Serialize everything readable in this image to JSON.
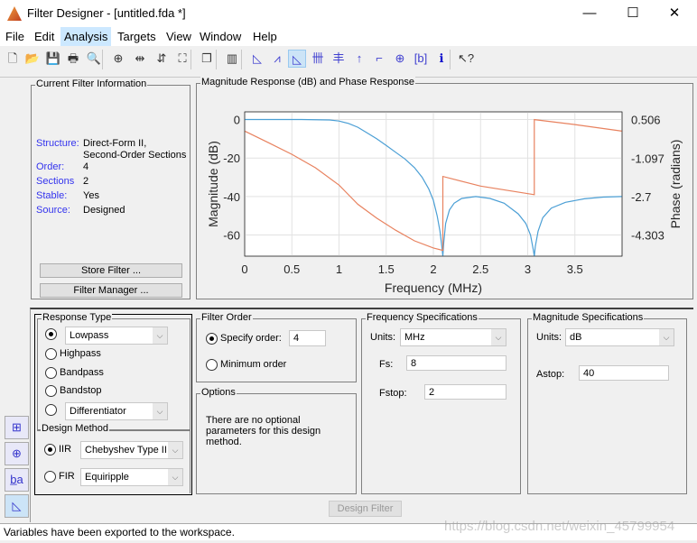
{
  "window": {
    "title": "Filter Designer -  [untitled.fda *]",
    "minimize": "—",
    "maximize": "☐",
    "close": "✕"
  },
  "menu": [
    "File",
    "Edit",
    "Analysis",
    "Targets",
    "View",
    "Window",
    "Help"
  ],
  "toolbar": [
    {
      "icon": "new-icon",
      "glyph": "🗋"
    },
    {
      "icon": "open-icon",
      "glyph": "📂"
    },
    {
      "icon": "save-icon",
      "glyph": "💾"
    },
    {
      "icon": "print-icon",
      "glyph": "🖶"
    },
    {
      "icon": "print-preview-icon",
      "glyph": "🔍"
    },
    {
      "icon": "zoom-in-icon",
      "glyph": "⊕"
    },
    {
      "icon": "zoom-x-icon",
      "glyph": "⇹"
    },
    {
      "icon": "zoom-y-icon",
      "glyph": "⇵"
    },
    {
      "icon": "full-view-icon",
      "glyph": "⛶"
    },
    {
      "icon": "new-window-icon",
      "glyph": "❐"
    },
    {
      "icon": "filter-spec-icon",
      "glyph": "▥"
    },
    {
      "icon": "magnitude-response-icon",
      "glyph": "◺"
    },
    {
      "icon": "phase-response-icon",
      "glyph": "⩘"
    },
    {
      "icon": "magnitude-phase-icon",
      "glyph": "◺",
      "selected": true
    },
    {
      "icon": "group-delay-icon",
      "glyph": "卌"
    },
    {
      "icon": "phase-delay-icon",
      "glyph": "丰"
    },
    {
      "icon": "impulse-response-icon",
      "glyph": "↑"
    },
    {
      "icon": "step-response-icon",
      "glyph": "⌐"
    },
    {
      "icon": "pole-zero-icon",
      "glyph": "⊕"
    },
    {
      "icon": "coefficients-icon",
      "glyph": "[b]"
    },
    {
      "icon": "info-icon",
      "glyph": "ℹ"
    },
    {
      "icon": "whats-this-help-icon",
      "glyph": "↖?"
    }
  ],
  "info": {
    "title": "Current Filter Information",
    "rows": [
      {
        "k": "Structure:",
        "v": "Direct-Form II,",
        "v2": "Second-Order Sections"
      },
      {
        "k": "Order:",
        "v": "4"
      },
      {
        "k": "Sections",
        "v": "2"
      },
      {
        "k": "Stable:",
        "v": "Yes"
      },
      {
        "k": "Source:",
        "v": "Designed"
      }
    ],
    "store": "Store Filter ...",
    "manager": "Filter Manager ..."
  },
  "chart_data": {
    "type": "line",
    "title": "Magnitude Response (dB) and Phase Response",
    "xlabel": "Frequency (MHz)",
    "ylabel": "Magnitude (dB)",
    "y2label": "Phase (radians)",
    "xlim": [
      0,
      4
    ],
    "ylim": [
      -71,
      4
    ],
    "y2lim": [
      -5.18,
      0.83
    ],
    "xticks": [
      "0",
      "0.5",
      "1",
      "1.5",
      "2",
      "2.5",
      "3",
      "3.5"
    ],
    "yticks": [
      "0",
      "-20",
      "-40",
      "-60"
    ],
    "y2ticks": [
      "0.506",
      "-1.097",
      "-2.7",
      "-4.303"
    ],
    "grid": true,
    "series": [
      {
        "color": "#4b9fd5",
        "axis": "left",
        "x": [
          0,
          0.6,
          0.9,
          1.0,
          1.1,
          1.2,
          1.3,
          1.4,
          1.5,
          1.6,
          1.7,
          1.8,
          1.88,
          1.95,
          2.0,
          2.04,
          2.07,
          2.09,
          2.1,
          2.11,
          2.13,
          2.17,
          2.22,
          2.3,
          2.45,
          2.6,
          2.75,
          2.9,
          2.98,
          3.03,
          3.06,
          3.07,
          3.08,
          3.11,
          3.16,
          3.25,
          3.4,
          3.6,
          3.8,
          4.0
        ],
        "y": [
          0,
          0,
          -0.2,
          -0.8,
          -2,
          -4,
          -7,
          -10,
          -13.5,
          -17,
          -20.5,
          -25,
          -30,
          -36,
          -42,
          -50,
          -58,
          -66,
          -71,
          -64,
          -54,
          -47,
          -43.5,
          -41,
          -40,
          -41,
          -43.5,
          -49,
          -54,
          -60,
          -68,
          -71,
          -66,
          -58,
          -51,
          -46,
          -43,
          -41.2,
          -40.3,
          -40
        ]
      },
      {
        "color": "#e8825f",
        "axis": "right",
        "x": [
          0,
          0.25,
          0.5,
          0.75,
          1.0,
          1.2,
          1.4,
          1.6,
          1.8,
          2.0,
          2.1,
          2.1,
          2.5,
          3.07,
          3.07,
          3.5,
          4.0
        ],
        "y": [
          0.03,
          -0.45,
          -0.94,
          -1.5,
          -2.22,
          -3.02,
          -3.6,
          -4.1,
          -4.54,
          -4.84,
          -4.94,
          -1.86,
          -2.26,
          -2.62,
          0.506,
          0.3,
          0.025
        ]
      }
    ]
  },
  "response": {
    "title": "Response Type",
    "lowpass": "Lowpass",
    "highpass": "Highpass",
    "bandpass": "Bandpass",
    "bandstop": "Bandstop",
    "other": "Differentiator"
  },
  "method": {
    "title": "Design Method",
    "iir": "IIR",
    "iir_type": "Chebyshev Type II",
    "fir": "FIR",
    "fir_type": "Equiripple"
  },
  "order": {
    "title": "Filter Order",
    "specify": "Specify order:",
    "value": "4",
    "minimum": "Minimum order"
  },
  "options": {
    "title": "Options",
    "text": "There are no optional parameters for this design method."
  },
  "freq": {
    "title": "Frequency Specifications",
    "units_label": "Units:",
    "units": "MHz",
    "fs_label": "Fs:",
    "fs": "8",
    "fstop_label": "Fstop:",
    "fstop": "2"
  },
  "mag": {
    "title": "Magnitude Specifications",
    "units_label": "Units:",
    "units": "dB",
    "astop_label": "Astop:",
    "astop": "40"
  },
  "design_button": "Design Filter",
  "status": "Variables have been exported to the workspace.",
  "watermark": "https://blog.csdn.net/weixin_45799954"
}
